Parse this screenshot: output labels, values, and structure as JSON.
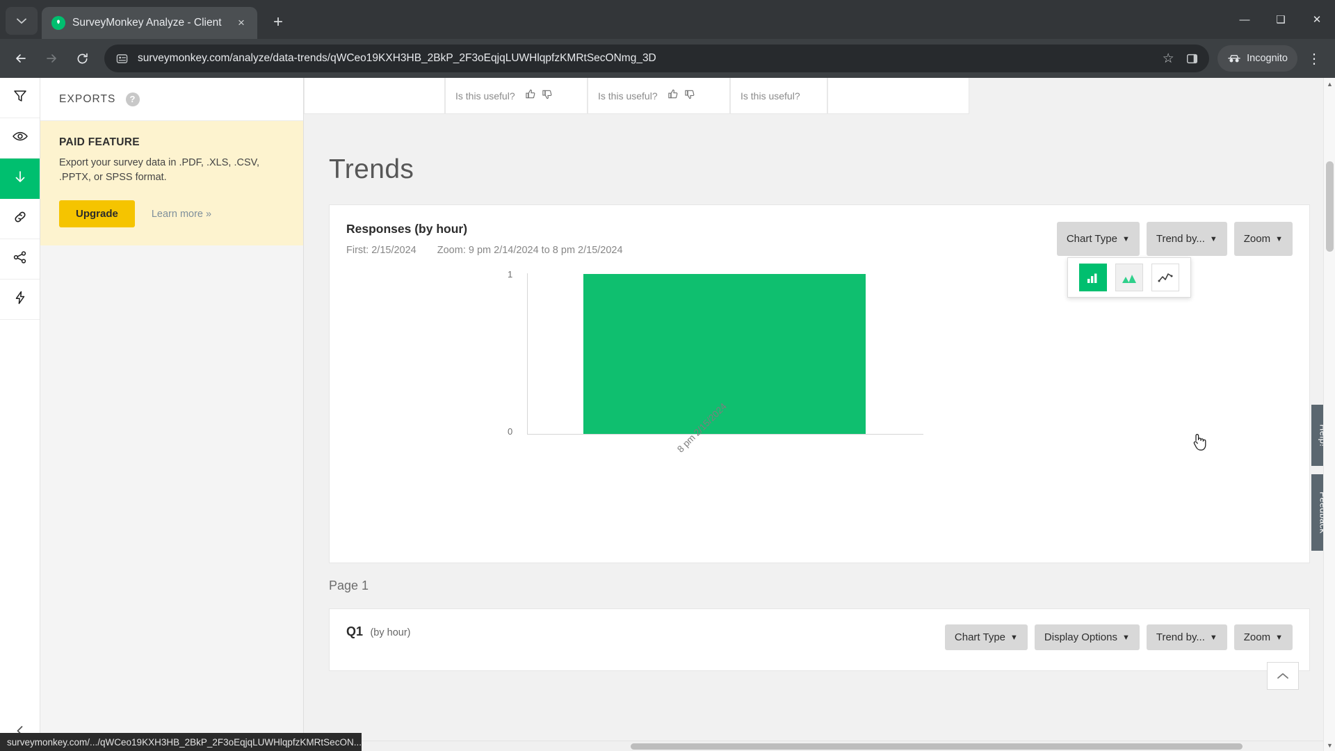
{
  "browser": {
    "tab": {
      "title": "SurveyMonkey Analyze - Client",
      "favicon": "surveymonkey-logo-icon",
      "close": "×"
    },
    "newtab_label": "+",
    "tablist_label": "⌄",
    "window": {
      "minimize": "—",
      "maximize": "❑",
      "close": "✕"
    },
    "nav": {
      "back": "←",
      "forward": "→",
      "reload": "↻"
    },
    "omnibox": {
      "url": "surveymonkey.com/analyze/data-trends/qWCeo19KXH3HB_2BkP_2F3oEqjqLUWHlqpfzKMRtSecONmg_3D",
      "site_info_icon": "site-settings-icon",
      "bookmark_icon": "☆",
      "sidepanel_icon": "side-panel-icon"
    },
    "incognito_label": "Incognito",
    "menu_icon": "⋮",
    "status_url": "surveymonkey.com/.../qWCeo19KXH3HB_2BkP_2F3oEqjqLUWHlqpfzKMRtSecON..."
  },
  "rail": {
    "items": [
      {
        "name": "filter",
        "glyph": "filter-icon",
        "active": false
      },
      {
        "name": "show-hide",
        "glyph": "eye-icon",
        "active": false
      },
      {
        "name": "exports",
        "glyph": "download-icon",
        "active": true
      },
      {
        "name": "share-link",
        "glyph": "link-icon",
        "active": false
      },
      {
        "name": "share",
        "glyph": "share-icon",
        "active": false
      },
      {
        "name": "integrations",
        "glyph": "bolt-icon",
        "active": false
      }
    ],
    "collapse_label": "‹"
  },
  "panel": {
    "title": "EXPORTS",
    "help_glyph": "?",
    "paid": {
      "label": "PAID FEATURE",
      "description": "Export your survey data in .PDF, .XLS, .CSV, .PPTX, or SPSS format.",
      "upgrade_label": "Upgrade",
      "learn_more_label": "Learn more »"
    }
  },
  "useful_bar": {
    "prompt": "Is this useful?",
    "thumbs_up": "thumbs-up-icon",
    "thumbs_down": "thumbs-down-icon",
    "count": 3
  },
  "main": {
    "page_title": "Trends",
    "page_footer": "Page 1",
    "card": {
      "title": "Responses (by hour)",
      "first_label": "First: 2/15/2024",
      "zoom_label": "Zoom: 9 pm 2/14/2024 to 8 pm 2/15/2024",
      "controls": [
        {
          "label": "Chart Type",
          "caret": "▼"
        },
        {
          "label": "Trend by...",
          "caret": "▼"
        },
        {
          "label": "Zoom",
          "caret": "▼"
        }
      ],
      "chart_type_popup": {
        "options": [
          {
            "name": "bar-chart",
            "state": "selected"
          },
          {
            "name": "area-chart",
            "state": "hovered"
          },
          {
            "name": "line-chart",
            "state": "normal"
          }
        ]
      }
    },
    "question_card": {
      "label": "Q1",
      "sub": "(by hour)",
      "controls": [
        {
          "label": "Chart Type",
          "caret": "▼"
        },
        {
          "label": "Display Options",
          "caret": "▼"
        },
        {
          "label": "Trend by...",
          "caret": "▼"
        },
        {
          "label": "Zoom",
          "caret": "▼"
        }
      ]
    },
    "scroll_top_icon": "chevron-up-icon",
    "side_tabs": [
      {
        "label": "Help!",
        "icon": "question-circle-icon"
      },
      {
        "label": "Feedback",
        "icon": ""
      }
    ]
  },
  "chart_data": {
    "type": "bar",
    "title": "Responses (by hour)",
    "subtitle": "First: 2/15/2024   Zoom: 9 pm 2/14/2024 to 8 pm 2/15/2024",
    "categories": [
      "8 pm 2/15/2024"
    ],
    "values": [
      1
    ],
    "xlabel": "",
    "ylabel": "",
    "ylim": [
      0,
      1
    ],
    "yticks": [
      "0",
      "1"
    ],
    "grid": false,
    "series_color": "#0fbf6f",
    "legend": "none"
  },
  "colors": {
    "brand_green": "#00bf6f",
    "bar_green": "#0fbf6f",
    "upgrade_yellow": "#f5c400",
    "paid_bg": "#fdf3cf",
    "chrome_dark": "#3c4043"
  }
}
